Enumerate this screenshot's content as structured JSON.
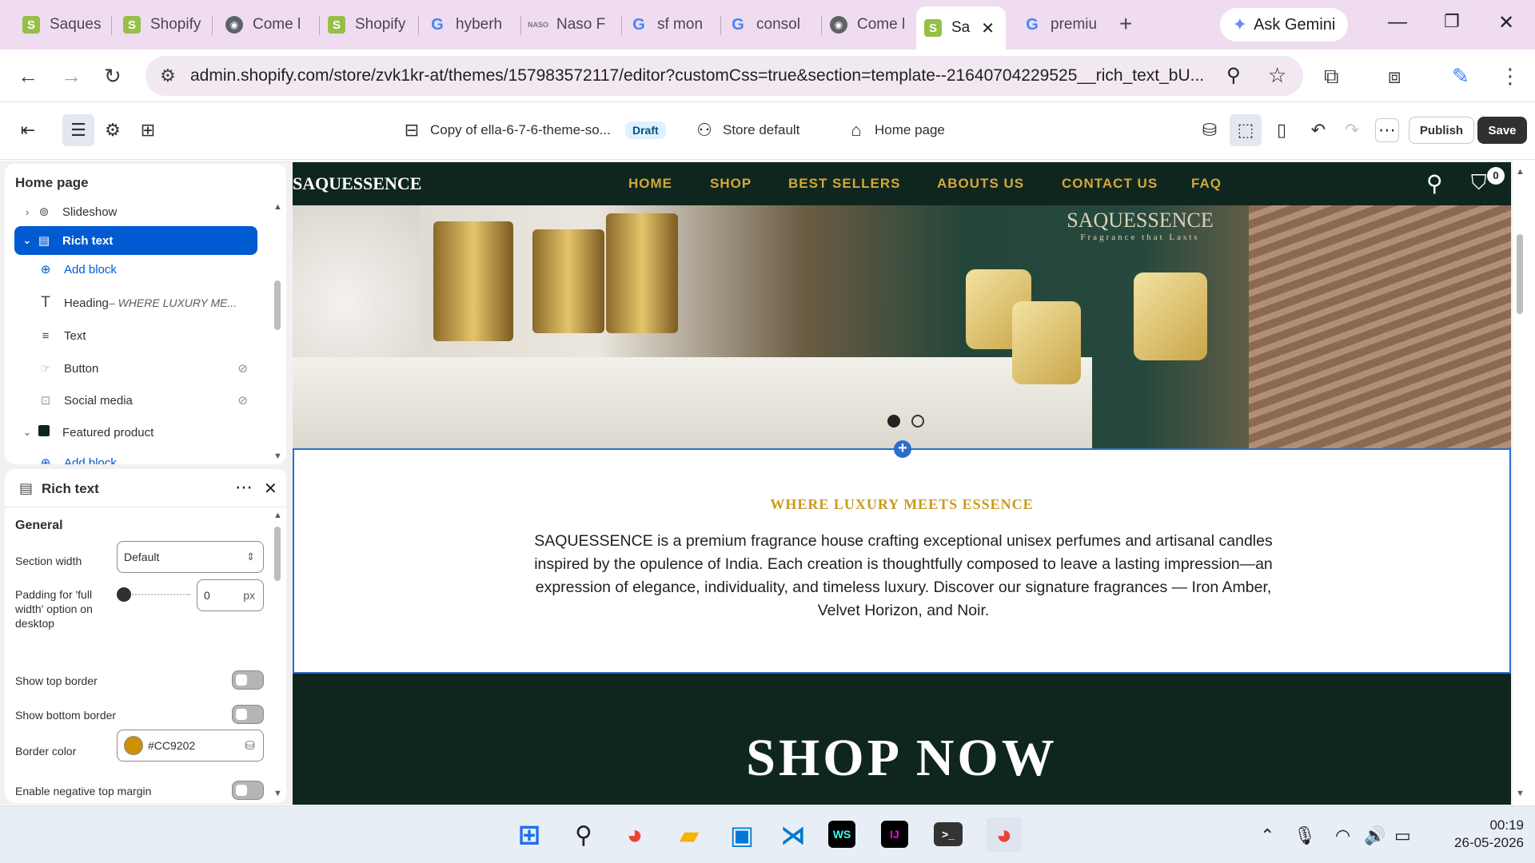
{
  "browser": {
    "tabs": [
      {
        "title": "Saques",
        "icon": "shopify-icon"
      },
      {
        "title": "Shopify",
        "icon": "shopify-icon"
      },
      {
        "title": "Come l",
        "icon": "globe-icon"
      },
      {
        "title": "Shopify",
        "icon": "shopify-icon"
      },
      {
        "title": "hyberh",
        "icon": "google-icon"
      },
      {
        "title": "Naso F",
        "icon": "naso-icon"
      },
      {
        "title": "sf mon",
        "icon": "google-icon"
      },
      {
        "title": "consol",
        "icon": "google-icon"
      },
      {
        "title": "Come l",
        "icon": "globe-icon"
      },
      {
        "title": "Sa",
        "icon": "shopify-icon",
        "active": true
      },
      {
        "title": "premiu",
        "icon": "google-icon"
      }
    ],
    "ask_gemini": "Ask Gemini",
    "url": "admin.shopify.com/store/zvk1kr-at/themes/157983572117/editor?customCss=true&section=template--21640704229525__rich_text_bU..."
  },
  "editor": {
    "theme_name": "Copy of ella-6-7-6-theme-so...",
    "draft_badge": "Draft",
    "store_default": "Store default",
    "page": "Home page",
    "publish": "Publish",
    "save": "Save"
  },
  "sidebar": {
    "title": "Home page",
    "items": [
      {
        "label": "Slideshow",
        "suffix": ""
      },
      {
        "label": "Rich text",
        "suffix": ""
      },
      {
        "label": "Add block",
        "suffix": ""
      },
      {
        "label": "Heading",
        "suffix": " – WHERE LUXURY ME..."
      },
      {
        "label": "Text",
        "suffix": ""
      },
      {
        "label": "Button",
        "suffix": ""
      },
      {
        "label": "Social media",
        "suffix": ""
      },
      {
        "label": "Featured product",
        "suffix": ""
      },
      {
        "label": "Add block",
        "suffix": ""
      }
    ]
  },
  "settings": {
    "title": "Rich text",
    "group": "General",
    "section_width_label": "Section width",
    "section_width_value": "Default",
    "padding_label": "Padding for 'full width' option on desktop",
    "padding_value": "0",
    "padding_unit": "px",
    "show_top_border": "Show top border",
    "show_bottom_border": "Show bottom border",
    "border_color_label": "Border color",
    "border_color_value": "#CC9202",
    "negative_margin": "Enable negative top margin",
    "colors": {
      "border": "#CC9202",
      "accent": "#005bd3"
    }
  },
  "site": {
    "logo": "SAQUESSENCE",
    "nav": [
      "HOME",
      "SHOP",
      "BEST SELLERS",
      "ABOUTS US",
      "CONTACT US",
      "FAQ"
    ],
    "cart_count": "0",
    "hero_brand": "SAQUESSENCE",
    "hero_tagline": "Fragrance that Lasts",
    "rich_heading": "WHERE LUXURY MEETS ESSENCE",
    "rich_body": "SAQUESSENCE is a premium fragrance house crafting exceptional unisex perfumes and artisanal candles inspired by the opulence of India. Each creation is thoughtfully composed to leave a lasting impression—an expression of elegance, individuality, and timeless luxury. Discover our signature fragrances — Iron Amber, Velvet Horizon, and Noir.",
    "shop_now": "SHOP NOW",
    "colors": {
      "nav_bg": "#0f261e",
      "nav_link": "#d4a73b",
      "heading": "#c99a1e"
    }
  },
  "taskbar": {
    "time": "00:19",
    "date": "26-05-2026"
  }
}
